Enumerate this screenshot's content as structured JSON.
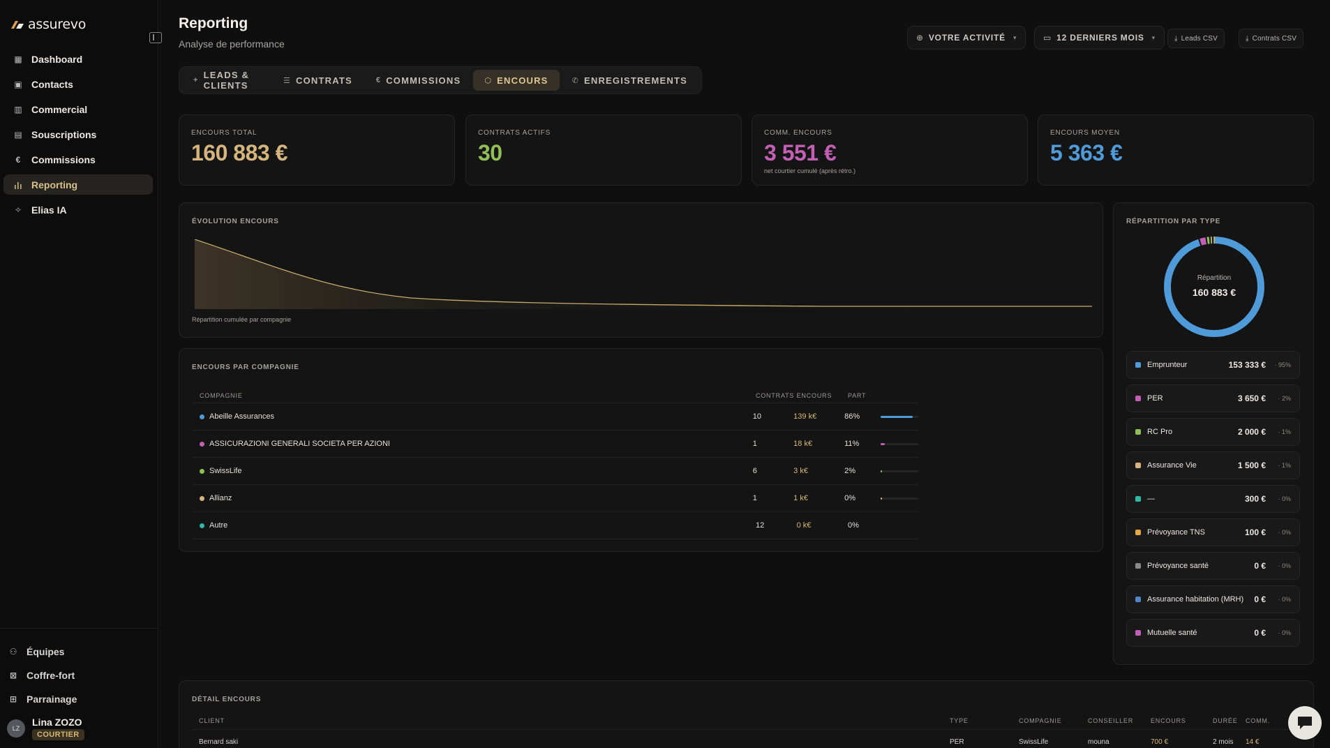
{
  "app": {
    "logo_text": "assurevo"
  },
  "sidebar": {
    "items": [
      {
        "label": "Dashboard",
        "icon": "dashboard-icon"
      },
      {
        "label": "Contacts",
        "icon": "contacts-icon"
      },
      {
        "label": "Commercial",
        "icon": "building-icon"
      },
      {
        "label": "Souscriptions",
        "icon": "document-icon"
      },
      {
        "label": "Commissions",
        "icon": "euro-icon"
      },
      {
        "label": "Reporting",
        "icon": "bar-chart-icon",
        "active": true
      },
      {
        "label": "Elias IA",
        "icon": "sparkle-icon"
      }
    ],
    "bottom": [
      {
        "label": "Équipes",
        "icon": "team-icon"
      },
      {
        "label": "Coffre-fort",
        "icon": "vault-icon"
      },
      {
        "label": "Parrainage",
        "icon": "gift-icon"
      }
    ],
    "user": {
      "initials": "LZ",
      "name": "Lina ZOZO",
      "role": "COURTIER"
    }
  },
  "header": {
    "title": "Reporting",
    "subtitle": "Analyse de performance",
    "activity_label": "VOTRE ACTIVITÉ",
    "period_label": "12 DERNIERS MOIS",
    "leads_csv": "Leads CSV",
    "contrats_csv": "Contrats CSV"
  },
  "tabs": [
    {
      "label": "LEADS & CLIENTS",
      "icon": "+"
    },
    {
      "label": "CONTRATS",
      "icon": "☰"
    },
    {
      "label": "COMMISSIONS",
      "icon": "€"
    },
    {
      "label": "ENCOURS",
      "icon": "⬡",
      "active": true
    },
    {
      "label": "ENREGISTREMENTS",
      "icon": "✆"
    }
  ],
  "kpis": [
    {
      "label": "ENCOURS TOTAL",
      "value": "160 883 €",
      "color": "#d5b57d",
      "note": ""
    },
    {
      "label": "CONTRATS ACTIFS",
      "value": "30",
      "color": "#8fbf55",
      "note": ""
    },
    {
      "label": "COMM. ENCOURS",
      "value": "3 551 €",
      "color": "#c35fb4",
      "note": "net courtier cumulé (après rétro.)"
    },
    {
      "label": "ENCOURS MOYEN",
      "value": "5 363 €",
      "color": "#4f9ad8",
      "note": ""
    }
  ],
  "evolution": {
    "title": "ÉVOLUTION ENCOURS",
    "caption": "Répartition cumulée par compagnie",
    "line_color": "#c9ab6c"
  },
  "par_compagnie": {
    "title": "ENCOURS PAR COMPAGNIE",
    "headers": {
      "compagnie": "COMPAGNIE",
      "contrats": "CONTRATS",
      "encours": "ENCOURS",
      "part": "PART"
    },
    "rows": [
      {
        "compagnie": "Abeille Assurances",
        "contrats": "10",
        "encours": "139 k€",
        "part": "86%",
        "share": 0.86,
        "color": "#4f9ad8"
      },
      {
        "compagnie": "ASSICURAZIONI GENERALI SOCIETA PER AZIONI",
        "contrats": "1",
        "encours": "18 k€",
        "part": "11%",
        "share": 0.11,
        "color": "#c35fb4"
      },
      {
        "compagnie": "SwissLife",
        "contrats": "6",
        "encours": "3 k€",
        "part": "2%",
        "share": 0.02,
        "color": "#8fbf55"
      },
      {
        "compagnie": "Allianz",
        "contrats": "1",
        "encours": "1 k€",
        "part": "0%",
        "share": 0.005,
        "color": "#d5b57d"
      },
      {
        "compagnie": "Autre",
        "contrats": "12",
        "encours": "0 k€",
        "part": "0%",
        "share": 0.0,
        "color": "#2fb9a5"
      }
    ]
  },
  "repartition": {
    "title": "RÉPARTITION PAR TYPE",
    "center_label": "Répartition",
    "center_value": "160 883 €",
    "items": [
      {
        "name": "Emprunteur",
        "value": "153 333 €",
        "pct": "· 95%",
        "share": 0.953,
        "color": "#4f9ad8"
      },
      {
        "name": "PER",
        "value": "3 650 €",
        "pct": "· 2%",
        "share": 0.023,
        "color": "#c35fb4"
      },
      {
        "name": "RC Pro",
        "value": "2 000 €",
        "pct": "· 1%",
        "share": 0.012,
        "color": "#8fbf55"
      },
      {
        "name": "Assurance Vie",
        "value": "1 500 €",
        "pct": "· 1%",
        "share": 0.009,
        "color": "#d5b57d"
      },
      {
        "name": "—",
        "value": "300 €",
        "pct": "· 0%",
        "share": 0.002,
        "color": "#2fb9a5"
      },
      {
        "name": "Prévoyance TNS",
        "value": "100 €",
        "pct": "· 0%",
        "share": 0.001,
        "color": "#e3a640"
      },
      {
        "name": "Prévoyance santé",
        "value": "0 €",
        "pct": "· 0%",
        "share": 0,
        "color": "#8a8a8a"
      },
      {
        "name": "Assurance habitation (MRH)",
        "value": "0 €",
        "pct": "· 0%",
        "share": 0,
        "color": "#4f86c6"
      },
      {
        "name": "Mutuelle santé",
        "value": "0 €",
        "pct": "· 0%",
        "share": 0,
        "color": "#c35fb4"
      }
    ]
  },
  "detail": {
    "title": "DÉTAIL ENCOURS",
    "headers": [
      "CLIENT",
      "TYPE",
      "COMPAGNIE",
      "CONSEILLER",
      "ENCOURS",
      "DURÉE",
      "COMM."
    ],
    "row": [
      "Bernard saki",
      "PER",
      "SwissLife",
      "mouna",
      "700 €",
      "2 mois",
      "14 €"
    ]
  }
}
